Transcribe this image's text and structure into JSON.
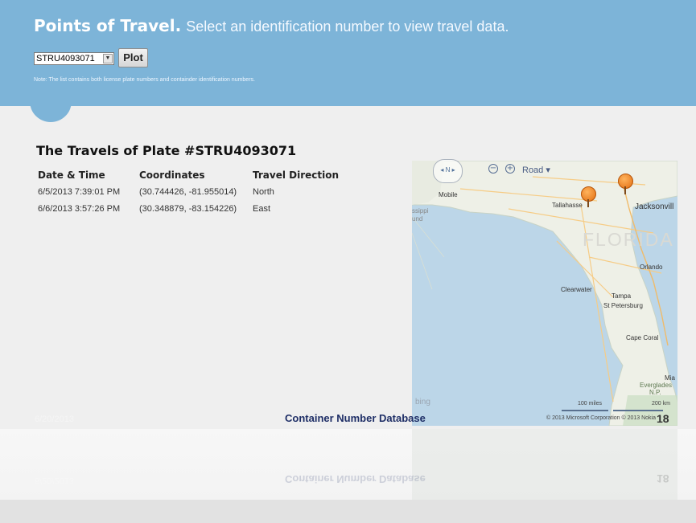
{
  "header": {
    "title_strong": "Points of Travel.",
    "title_rest": "Select an identification number to view travel data.",
    "select_value": "STRU4093071",
    "plot_label": "Plot",
    "note": "Note: The list contains both license plate numbers and containder identification numbers."
  },
  "main": {
    "title": "The Travels of Plate #STRU4093071",
    "columns": [
      "Date & Time",
      "Coordinates",
      "Travel Direction"
    ],
    "rows": [
      {
        "datetime": "6/5/2013 7:39:01 PM",
        "coords": "(30.744426, -81.955014)",
        "direction": "North"
      },
      {
        "datetime": "6/6/2013 3:57:26 PM",
        "coords": "(30.348879, -83.154226)",
        "direction": "East"
      }
    ]
  },
  "map": {
    "compass": "N",
    "road_label": "Road",
    "labels": {
      "mobile": "Mobile",
      "tallahassee": "Tallahasse",
      "jacksonville": "Jacksonvill",
      "florida": "FLORIDA",
      "orlando": "Orlando",
      "clearwater": "Clearwater",
      "tampa": "Tampa",
      "st_petersburg": "St Petersburg",
      "cape_coral": "Cape Coral",
      "mia": "Mia",
      "everglades": "Everglades",
      "np": "N.P.",
      "ssippi": "ssippi",
      "und": "und"
    },
    "bing": "bing",
    "scale_miles": "100 miles",
    "scale_km": "200 km",
    "copyright": "© 2013 Microsoft Corporation   © 2013 Nokia"
  },
  "footer": {
    "date": "6/20/2013",
    "database": "Container Number Database",
    "slide_number": "18"
  },
  "colors": {
    "header": "#7db4d8",
    "marker": "#e8791c",
    "footer_text": "#1e2e66"
  }
}
